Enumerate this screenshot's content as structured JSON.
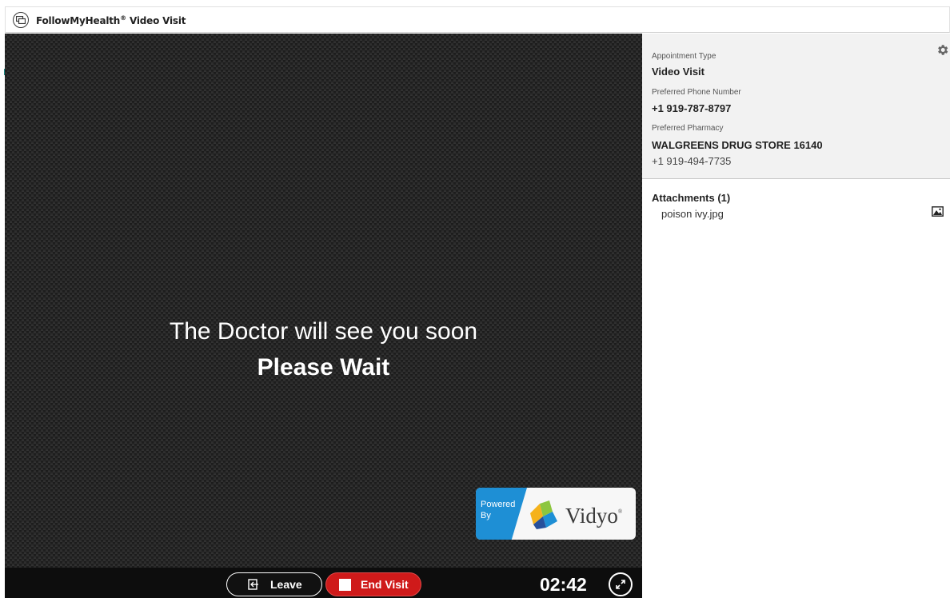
{
  "window": {
    "title": "FollowMyHealth",
    "title_mark": "®",
    "title_suffix": " Video Visit"
  },
  "video": {
    "message": "The Doctor will see you soon",
    "submessage": "Please Wait",
    "badge": {
      "powered_line1": "Powered",
      "powered_line2": "By",
      "brand": "Vidyo",
      "brand_mark": "®"
    }
  },
  "controls": {
    "leave_label": "Leave",
    "end_label": "End Visit",
    "timer": "02:42"
  },
  "details": {
    "appointment_type_label": "Appointment Type",
    "appointment_type": "Video Visit",
    "phone_label": "Preferred Phone Number",
    "phone": "+1 919-787-8797",
    "pharmacy_label": "Preferred Pharmacy",
    "pharmacy_name": "WALGREENS DRUG STORE 16140",
    "pharmacy_phone": "+1 919-494-7735"
  },
  "attachments": {
    "title": "Attachments (1)",
    "items": [
      {
        "name": "poison ivy.jpg"
      }
    ]
  },
  "colors": {
    "end_button": "#cf1a1a",
    "vidyo_blue": "#1e8fd5",
    "panel_bg": "#f2f2f2"
  }
}
